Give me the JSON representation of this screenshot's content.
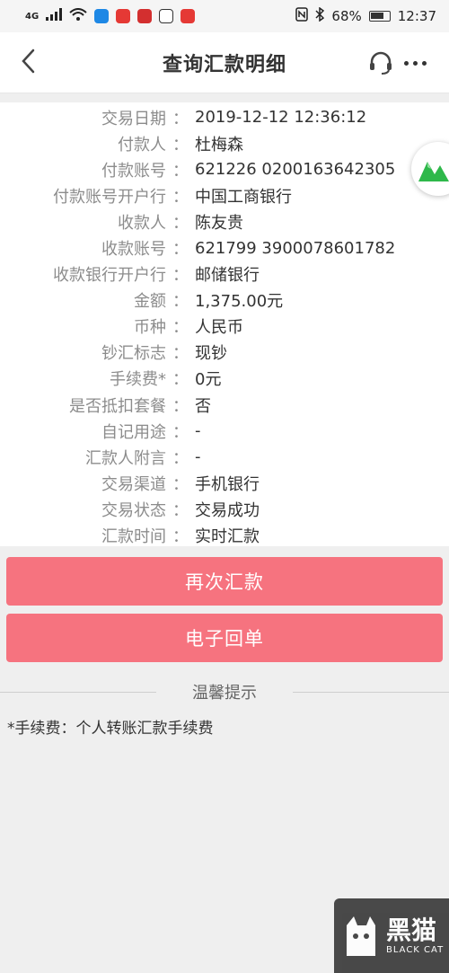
{
  "status_bar": {
    "network": "4G",
    "battery_percent": "68%",
    "time": "12:37",
    "app_icons": [
      "blue-app-icon",
      "red-app-icon",
      "red-app-icon",
      "bilibili-icon",
      "red-app-icon"
    ]
  },
  "nav": {
    "title": "查询汇款明细",
    "back_icon": "chevron-left-icon",
    "service_icon": "headset-icon",
    "more_icon": "more-dots-icon"
  },
  "details": [
    {
      "label": "交易日期",
      "value": "2019-12-12 12:36:12"
    },
    {
      "label": "付款人",
      "value": "杜梅森"
    },
    {
      "label": "付款账号",
      "value": "621226 0200163642305"
    },
    {
      "label": "付款账号开户行",
      "value": "中国工商银行"
    },
    {
      "label": "收款人",
      "value": "陈友贵"
    },
    {
      "label": "收款账号",
      "value": "621799 3900078601782"
    },
    {
      "label": "收款银行开户行",
      "value": "邮储银行"
    },
    {
      "label": "金额",
      "value": "1,375.00元"
    },
    {
      "label": "币种",
      "value": "人民币"
    },
    {
      "label": "钞汇标志",
      "value": "现钞"
    },
    {
      "label": "手续费*",
      "value": "0元"
    },
    {
      "label": "是否抵扣套餐",
      "value": "否"
    },
    {
      "label": "自记用途",
      "value": "-"
    },
    {
      "label": "汇款人附言",
      "value": "-"
    },
    {
      "label": "交易渠道",
      "value": "手机银行"
    },
    {
      "label": "交易状态",
      "value": "交易成功"
    },
    {
      "label": "汇款时间",
      "value": "实时汇款"
    }
  ],
  "colon": "：",
  "buttons": {
    "retransfer": "再次汇款",
    "receipt": "电子回单"
  },
  "tips": {
    "title": "温馨提示",
    "text": "*手续费：个人转账汇款手续费"
  },
  "watermark": {
    "cn": "黑猫",
    "en": "BLACK CAT"
  },
  "colors": {
    "accent_button": "#f6737f",
    "label_gray": "#8c8c8c",
    "page_bg": "#efefef"
  }
}
